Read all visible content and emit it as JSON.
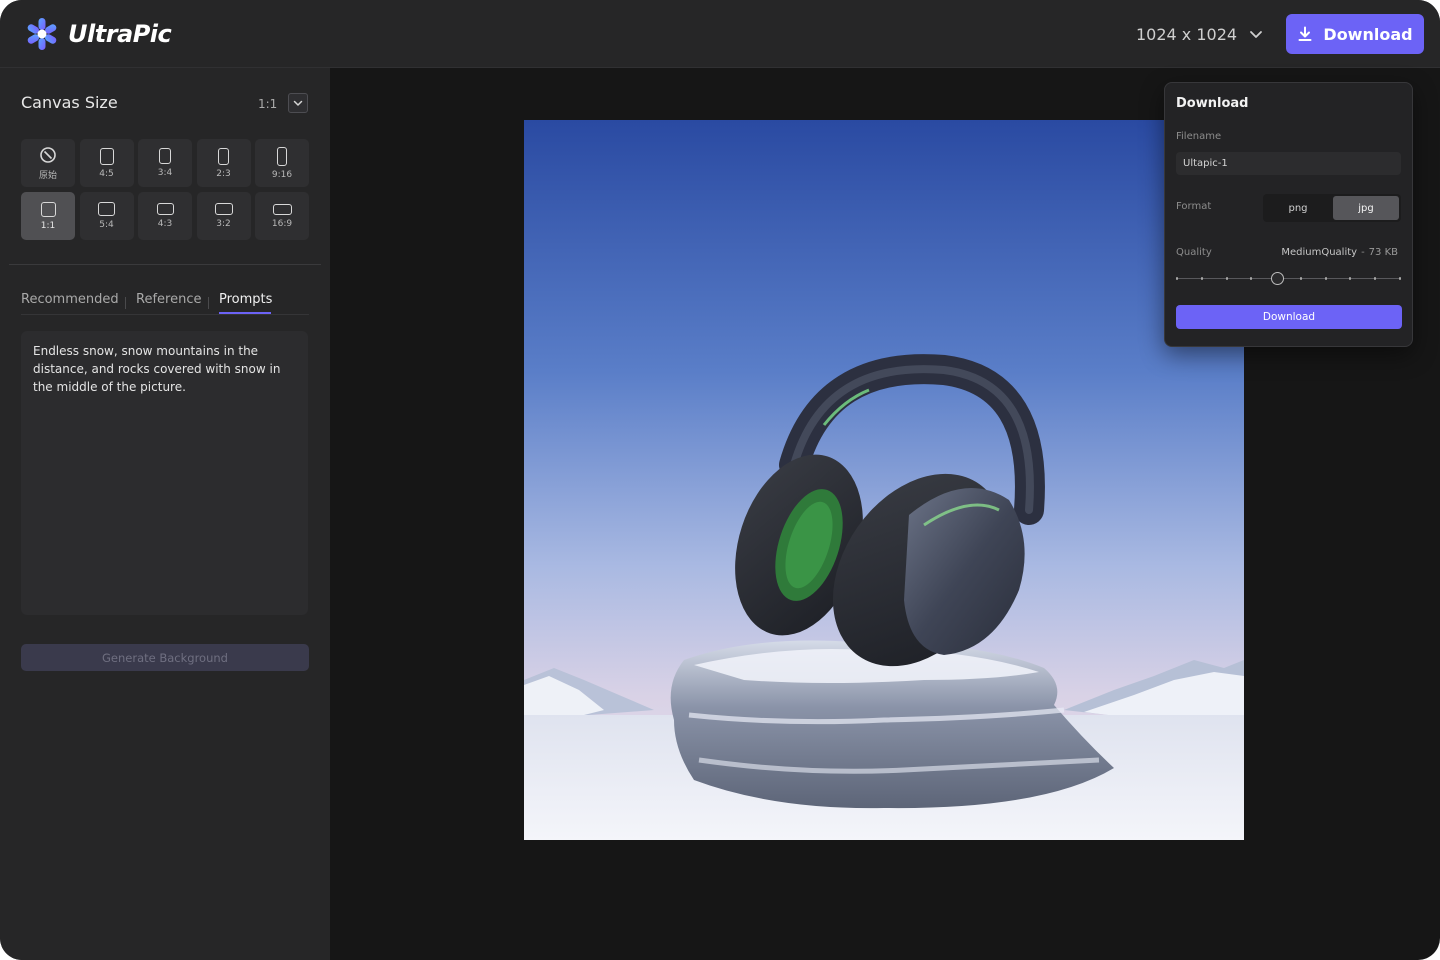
{
  "app": {
    "name": "UltraPic"
  },
  "header": {
    "size_value": "1024 x 1024",
    "download_label": "Download"
  },
  "sidebar": {
    "title": "Canvas Size",
    "ratio_value": "1:1",
    "ratios": [
      {
        "label": "原始",
        "selected": false
      },
      {
        "label": "4:5",
        "selected": false
      },
      {
        "label": "3:4",
        "selected": false
      },
      {
        "label": "2:3",
        "selected": false
      },
      {
        "label": "9:16",
        "selected": false
      },
      {
        "label": "1:1",
        "selected": true
      },
      {
        "label": "5:4",
        "selected": false
      },
      {
        "label": "4:3",
        "selected": false
      },
      {
        "label": "3:2",
        "selected": false
      },
      {
        "label": "16:9",
        "selected": false
      }
    ],
    "tabs": [
      {
        "label": "Recommended",
        "active": false
      },
      {
        "label": "Reference",
        "active": false
      },
      {
        "label": "Prompts",
        "active": true
      }
    ],
    "prompt_text": "Endless snow, snow mountains in the distance, and rocks covered with snow in the middle of the picture.",
    "generate_label": "Generate Background"
  },
  "download_panel": {
    "title": "Download",
    "filename_label": "Filename",
    "filename_value": "Ultapic-1",
    "format_label": "Format",
    "formats": [
      "png",
      "jpg"
    ],
    "format_selected": "jpg",
    "quality_label": "Quality",
    "quality_name": "MediumQuality",
    "quality_separator": "-",
    "quality_size": "73 KB",
    "quality_level": 0.45,
    "button_label": "Download"
  },
  "colors": {
    "accent": "#6c63f6",
    "background": "#161616",
    "panel": "#262627"
  }
}
